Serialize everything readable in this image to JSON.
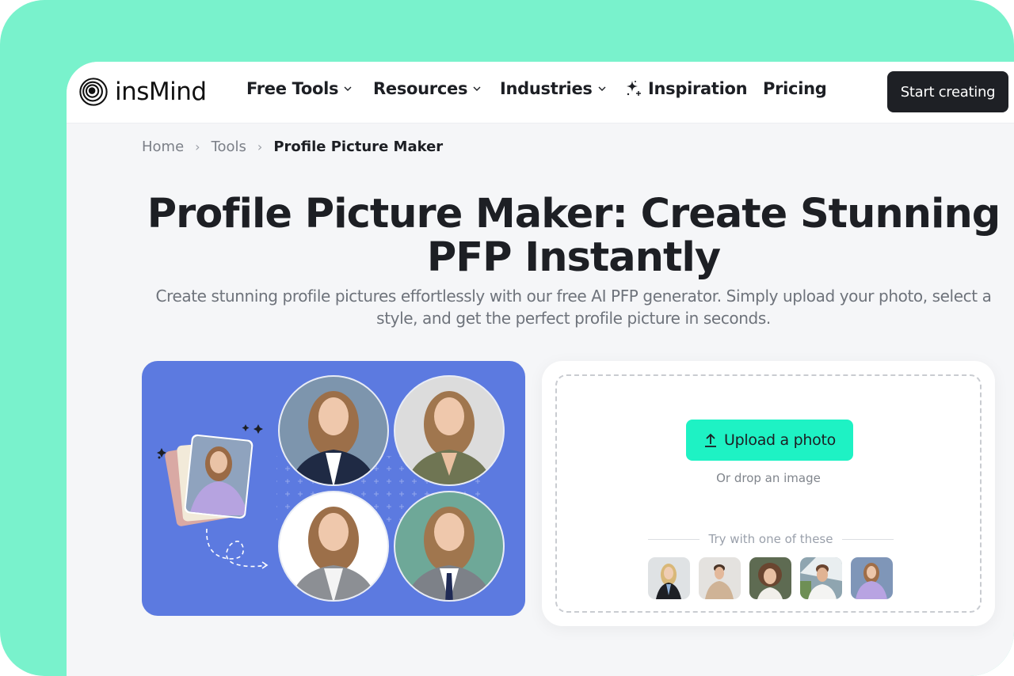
{
  "brand": {
    "name": "insMind",
    "accent_color": "#79f2cc",
    "cta_color": "#1ef2c4"
  },
  "nav": {
    "items": [
      {
        "label": "Free Tools",
        "has_dropdown": true
      },
      {
        "label": "Resources",
        "has_dropdown": true
      },
      {
        "label": "Industries",
        "has_dropdown": true
      },
      {
        "label": "Inspiration",
        "icon": "sparkle-icon"
      },
      {
        "label": "Pricing"
      }
    ],
    "cta_label": "Start creating"
  },
  "breadcrumb": [
    {
      "label": "Home"
    },
    {
      "label": "Tools"
    },
    {
      "label": "Profile Picture Maker"
    }
  ],
  "hero": {
    "title": "Profile Picture Maker: Create Stunning PFP Instantly",
    "subtitle": "Create stunning profile pictures effortlessly with our free AI PFP generator. Simply upload your photo, select a style, and get the perfect profile picture in seconds."
  },
  "illustration": {
    "description": "Source photo of smiling woman in lavender sweater transformed into four professional headshot variants",
    "variants": [
      {
        "name": "navy-blazer-blue-bg"
      },
      {
        "name": "olive-blazer-grey-bg"
      },
      {
        "name": "grey-blazer-white-bg"
      },
      {
        "name": "grey-blazer-tie-green-bg"
      }
    ]
  },
  "upload": {
    "button_label": "Upload a photo",
    "drop_text": "Or drop an image",
    "try_label": "Try with one of these",
    "samples": [
      {
        "name": "blonde-woman-black-blazer"
      },
      {
        "name": "man-beige-shirt"
      },
      {
        "name": "woman-short-brown-hair"
      },
      {
        "name": "man-white-shirt-outdoor"
      },
      {
        "name": "woman-lavender-sweater"
      }
    ]
  }
}
